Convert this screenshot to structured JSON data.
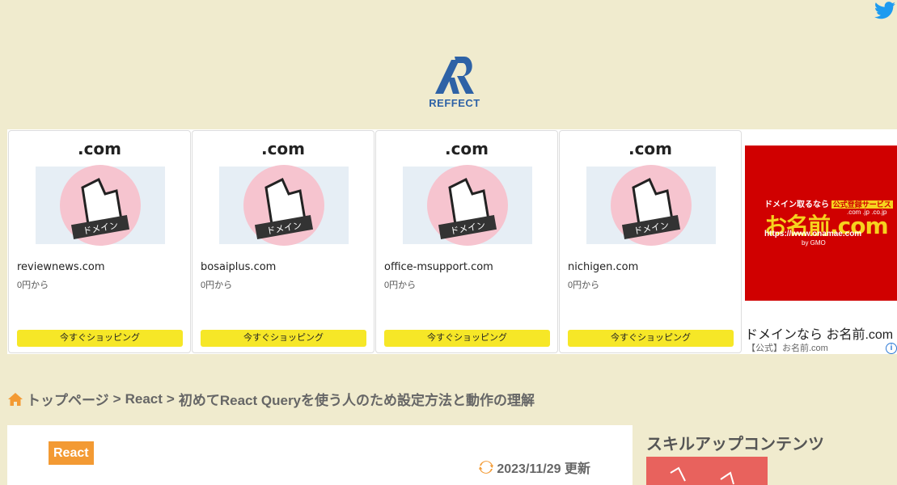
{
  "site": {
    "logo_text": "REFFECT"
  },
  "icons": {
    "twitter": "twitter-icon",
    "home": "home-icon",
    "refresh": "refresh-icon",
    "adchoices": "adchoices-icon"
  },
  "colors": {
    "background": "#f0ebce",
    "brand_blue": "#2e62a6",
    "accent_orange": "#f39a33",
    "shop_yellow": "#f6e727",
    "onamae_red": "#d00000"
  },
  "ads": {
    "cards": [
      {
        "tld": ".com",
        "badge": "ドメイン",
        "domain": "reviewnews.com",
        "price": "0円から",
        "button": "今すぐショッピング"
      },
      {
        "tld": ".com",
        "badge": "ドメイン",
        "domain": "bosaiplus.com",
        "price": "0円から",
        "button": "今すぐショッピング"
      },
      {
        "tld": ".com",
        "badge": "ドメイン",
        "domain": "office-msupport.com",
        "price": "0円から",
        "button": "今すぐショッピング"
      },
      {
        "tld": ".com",
        "badge": "ドメイン",
        "domain": "nichigen.com",
        "price": "0円から",
        "button": "今すぐショッピング"
      }
    ],
    "onamae": {
      "banner_line1": "ドメイン取るなら",
      "banner_badge": "公式登録サービス",
      "banner_tlds": ".com .jp .co.jp",
      "banner_big": "お名前.com",
      "banner_url": "https://www.onamae.com",
      "banner_gmo": "by GMO",
      "title": "ドメインなら お名前.com",
      "subtitle": "【公式】お名前.com",
      "adchoices": "i"
    }
  },
  "breadcrumb": {
    "home": "トップページ",
    "sep1": ">",
    "category": "React",
    "sep2": ">",
    "current": "初めてReact Queryを使う人のため設定方法と動作の理解"
  },
  "article": {
    "category": "React",
    "updated": "2023/11/29 更新"
  },
  "sidebar": {
    "title": "スキルアップコンテンツ"
  }
}
